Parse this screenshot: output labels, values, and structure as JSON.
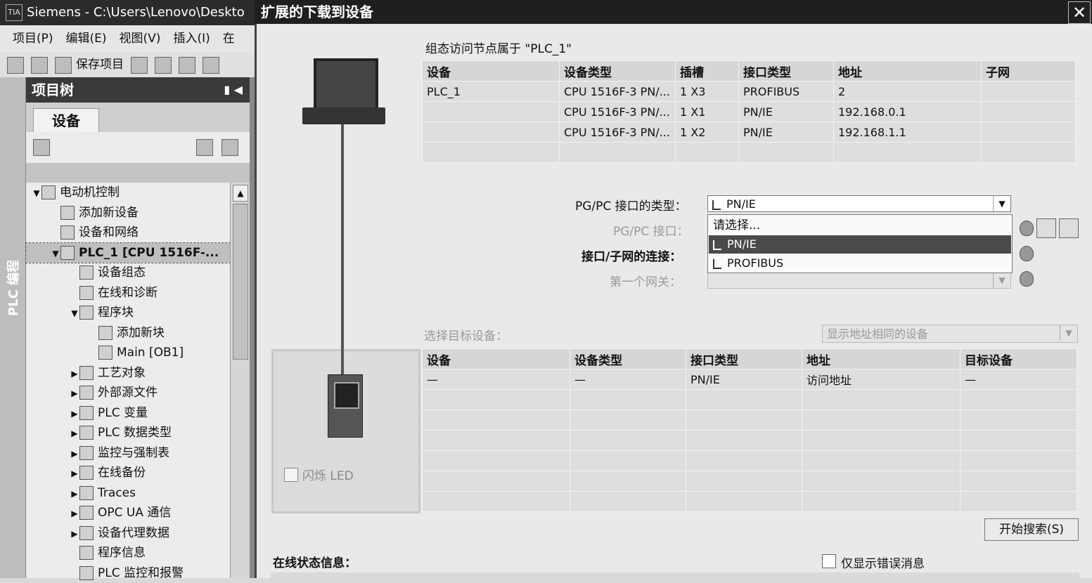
{
  "main_window": {
    "title": "Siemens  -  C:\\Users\\Lenovo\\Deskto",
    "logo": "TIA",
    "menu": [
      "项目(P)",
      "编辑(E)",
      "视图(V)",
      "插入(I)",
      "在"
    ],
    "toolbar": {
      "save_label": "保存项目"
    },
    "side_tab": "PLC 编程",
    "project_tree": {
      "title": "项目树",
      "tab": "设备",
      "items": [
        {
          "label": "电动机控制",
          "level": 0,
          "arrow": "down"
        },
        {
          "label": "添加新设备",
          "level": 1,
          "arrow": ""
        },
        {
          "label": "设备和网络",
          "level": 1,
          "arrow": ""
        },
        {
          "label": "PLC_1 [CPU 1516F-...",
          "level": 1,
          "arrow": "down",
          "selected": true
        },
        {
          "label": "设备组态",
          "level": 2,
          "arrow": ""
        },
        {
          "label": "在线和诊断",
          "level": 2,
          "arrow": ""
        },
        {
          "label": "程序块",
          "level": 2,
          "arrow": "down"
        },
        {
          "label": "添加新块",
          "level": 3,
          "arrow": ""
        },
        {
          "label": "Main [OB1]",
          "level": 3,
          "arrow": ""
        },
        {
          "label": "工艺对象",
          "level": 2,
          "arrow": "right"
        },
        {
          "label": "外部源文件",
          "level": 2,
          "arrow": "right"
        },
        {
          "label": "PLC 变量",
          "level": 2,
          "arrow": "right"
        },
        {
          "label": "PLC 数据类型",
          "level": 2,
          "arrow": "right"
        },
        {
          "label": "监控与强制表",
          "level": 2,
          "arrow": "right"
        },
        {
          "label": "在线备份",
          "level": 2,
          "arrow": "right"
        },
        {
          "label": "Traces",
          "level": 2,
          "arrow": "right"
        },
        {
          "label": "OPC UA 通信",
          "level": 2,
          "arrow": "right"
        },
        {
          "label": "设备代理数据",
          "level": 2,
          "arrow": "right"
        },
        {
          "label": "程序信息",
          "level": 2,
          "arrow": ""
        },
        {
          "label": "PLC 监控和报警",
          "level": 2,
          "arrow": ""
        }
      ]
    }
  },
  "dialog": {
    "title": "扩展的下载到设备",
    "close": "✕",
    "config_label": "组态访问节点属于 \"PLC_1\"",
    "config_table": {
      "headers": [
        "设备",
        "设备类型",
        "插槽",
        "接口类型",
        "地址",
        "子网"
      ],
      "rows": [
        [
          "PLC_1",
          "CPU 1516F-3 PN/...",
          "1 X3",
          "PROFIBUS",
          "2",
          ""
        ],
        [
          "",
          "CPU 1516F-3 PN/...",
          "1 X1",
          "PN/IE",
          "192.168.0.1",
          ""
        ],
        [
          "",
          "CPU 1516F-3 PN/...",
          "1 X2",
          "PN/IE",
          "192.168.1.1",
          ""
        ],
        [
          "",
          "",
          "",
          "",
          "",
          ""
        ]
      ]
    },
    "pgpc_type_label": "PG/PC 接口的类型：",
    "pgpc_type_value": "PN/IE",
    "pgpc_iface_label": "PG/PC 接口：",
    "subnet_conn_label": "接口/子网的连接：",
    "gateway_label": "第一个网关：",
    "dropdown_options": [
      "请选择...",
      "PN/IE",
      "PROFIBUS"
    ],
    "led_label": "闪烁 LED",
    "select_target_label": "选择目标设备：",
    "show_filter": "显示地址相同的设备",
    "target_table": {
      "headers": [
        "设备",
        "设备类型",
        "接口类型",
        "地址",
        "目标设备"
      ],
      "rows": [
        [
          "—",
          "—",
          "PN/IE",
          "访问地址",
          "—"
        ],
        [
          "",
          "",
          "",
          "",
          ""
        ],
        [
          "",
          "",
          "",
          "",
          ""
        ],
        [
          "",
          "",
          "",
          "",
          ""
        ],
        [
          "",
          "",
          "",
          "",
          ""
        ],
        [
          "",
          "",
          "",
          "",
          ""
        ],
        [
          "",
          "",
          "",
          "",
          ""
        ]
      ]
    },
    "start_search": "开始搜索(S)",
    "online_status_label": "在线状态信息：",
    "only_errors_label": "仅显示错误消息"
  }
}
